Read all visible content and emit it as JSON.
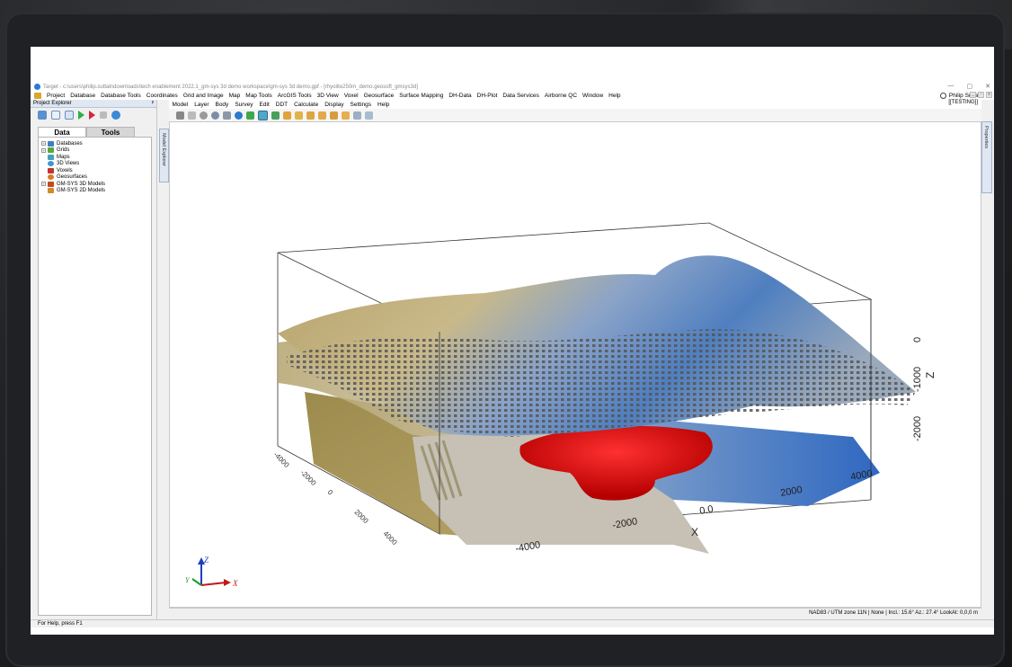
{
  "window": {
    "title": "Target - c:\\users\\philip.suttak\\downloads\\tech enablement 2022.1_gm-sys 3d demo workspace\\gm-sys 3d demo.gpf - [rhyolite250m_demo.geosoft_gmsys3d]",
    "minimize": "—",
    "maximize": "▢",
    "close": "✕"
  },
  "menu": [
    "Project",
    "Database",
    "Database Tools",
    "Coordinates",
    "Grid and Image",
    "Map",
    "Map Tools",
    "ArcGIS Tools",
    "3D View",
    "Voxel",
    "Geosurface",
    "Surface Mapping",
    "DH-Data",
    "DH-Plot",
    "Data Services",
    "Airborne QC",
    "Window",
    "Help"
  ],
  "user": {
    "name": "Philip Suttak"
  },
  "project_explorer": {
    "title": "Project Explorer",
    "pin": "ᵖ",
    "tabs": [
      {
        "label": "Data"
      },
      {
        "label": "Tools"
      }
    ],
    "tree": [
      {
        "label": "Databases",
        "icon": "database-icon",
        "color": "#3c7fc5",
        "expand": "+"
      },
      {
        "label": "Grids",
        "icon": "grid-icon",
        "color": "#5fa53a",
        "expand": "+"
      },
      {
        "label": "Maps",
        "icon": "map-icon",
        "color": "#48a0b8",
        "expand": ""
      },
      {
        "label": "3D Views",
        "icon": "3d-view-icon",
        "color": "#3c98d1",
        "expand": ""
      },
      {
        "label": "Voxels",
        "icon": "voxel-icon",
        "color": "#c0362c",
        "expand": ""
      },
      {
        "label": "Geosurfaces",
        "icon": "geosurface-icon",
        "color": "#d97a2a",
        "expand": ""
      },
      {
        "label": "GM-SYS 3D Models",
        "icon": "gmsys3d-model-icon",
        "color": "#c24a1f",
        "expand": "+"
      },
      {
        "label": "GM-SYS 2D Models",
        "icon": "gmsys2d-model-icon",
        "color": "#d08a30",
        "expand": ""
      }
    ]
  },
  "model_menu": [
    "Model",
    "Layer",
    "Body",
    "Survey",
    "Edit",
    "DDT",
    "Calculate",
    "Display",
    "Settings",
    "Help"
  ],
  "testing_label": "[[TESTING]]",
  "side_tabs": {
    "model_explorer": "Model Explorer",
    "properties": "Properties"
  },
  "viewport": {
    "axes": {
      "z_label": "Z",
      "x_label": "X",
      "z_ticks": [
        "0",
        "-1000",
        "-2000"
      ],
      "x_ticks": [
        "-4000",
        "-2000",
        "0.0",
        "2000",
        "4000"
      ],
      "y_ticks": [
        "-4000",
        "-2000",
        "0",
        "2000",
        "4000"
      ]
    },
    "triad": {
      "z": "Z",
      "x": "X",
      "y": "Y"
    }
  },
  "status": {
    "coords": "NAD83 / UTM zone 11N  |  None  |  Incl.: 15.6° Az.: 27.4° LookAt: 0,0,0 m",
    "help": "For Help, press F1"
  }
}
